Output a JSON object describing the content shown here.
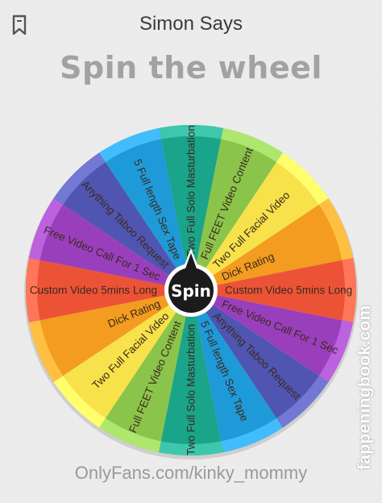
{
  "app": {
    "title": "Simon Says"
  },
  "headline": "Spin the wheel",
  "wheel": {
    "spin_label": "Spin",
    "segments": [
      {
        "label": "Two Full Solo Masturbation",
        "color": "#1aa489"
      },
      {
        "label": "Full FEET Video Content",
        "color": "#8bc44a"
      },
      {
        "label": "Two Full Facial Video",
        "color": "#f7e24b"
      },
      {
        "label": "Dick Rating",
        "color": "#f39c1f"
      },
      {
        "label": "Custom Video 5mins Long",
        "color": "#ec5336"
      },
      {
        "label": "Free Video Call For 1 Sec",
        "color": "#9a3fbb"
      },
      {
        "label": "Anything Taboo Request",
        "color": "#4f55b0"
      },
      {
        "label": "5 Full length Sex Tape",
        "color": "#1f9ad8"
      },
      {
        "label": "Two Full Solo Masturbation",
        "color": "#1aa489"
      },
      {
        "label": "Full FEET Video Content",
        "color": "#8bc44a"
      },
      {
        "label": "Two Full Facial Video",
        "color": "#f7e24b"
      },
      {
        "label": "Dick Rating",
        "color": "#f39c1f"
      },
      {
        "label": "Custom Video 5mins Long",
        "color": "#ec5336"
      },
      {
        "label": "Free Video Call For 1 Sec",
        "color": "#9a3fbb"
      },
      {
        "label": "Anything Taboo Request",
        "color": "#4f55b0"
      },
      {
        "label": "5 Full length Sex Tape",
        "color": "#1f9ad8"
      }
    ]
  },
  "watermarks": {
    "bottom": "OnlyFans.com/kinky_mommy",
    "side": "fappeningbook.com"
  }
}
